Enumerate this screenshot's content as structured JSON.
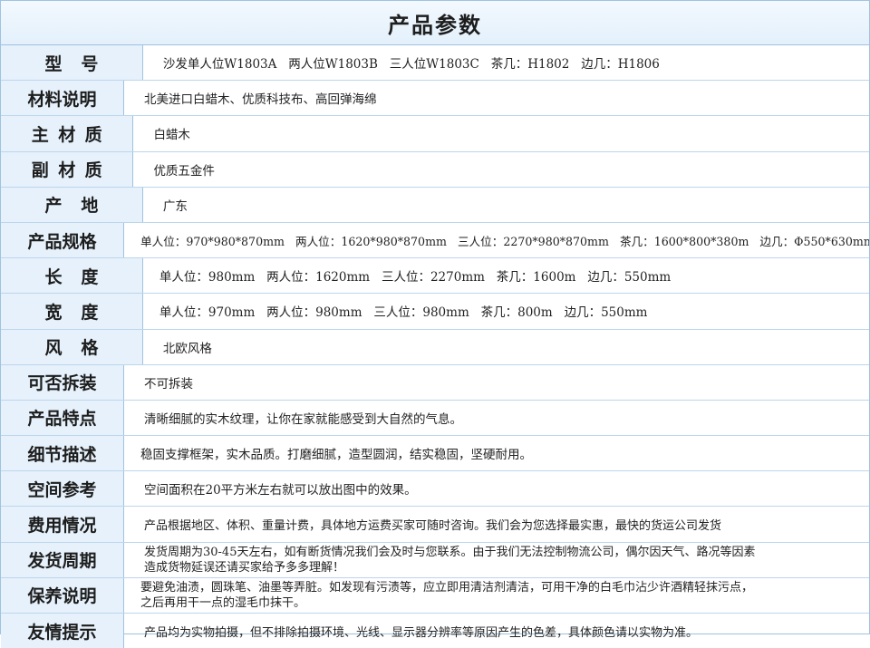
{
  "title": "产品参数",
  "rows": [
    {
      "label": "型号",
      "value": "沙发单人位W1803A   两人位W1803B   三人位W1803C   茶几：H1802   边几：H1806"
    },
    {
      "label": "材料说明",
      "value": "北美进口白蜡木、优质科技布、高回弹海绵"
    },
    {
      "label": "主材质",
      "value": "白蜡木"
    },
    {
      "label": "副材质",
      "value": "优质五金件"
    },
    {
      "label": "产地",
      "value": "广东"
    },
    {
      "label": "产品规格",
      "value": "单人位：970*980*870mm   两人位：1620*980*870mm   三人位：2270*980*870mm   茶几：1600*800*380m   边几：Φ550*630mm"
    },
    {
      "label": "长度",
      "value": "单人位：980mm   两人位：1620mm   三人位：2270mm   茶几：1600m   边几：550mm"
    },
    {
      "label": "宽度",
      "value": "单人位：970mm   两人位：980mm   三人位：980mm   茶几：800m   边几：550mm"
    },
    {
      "label": "风格",
      "value": "北欧风格"
    },
    {
      "label": "可否拆装",
      "value": "不可拆装"
    },
    {
      "label": "产品特点",
      "value": "清晰细腻的实木纹理，让你在家就能感受到大自然的气息。"
    },
    {
      "label": "细节描述",
      "value": "稳固支撑框架，实木品质。打磨细腻，造型圆润，结实稳固，坚硬耐用。"
    },
    {
      "label": "空间参考",
      "value": "空间面积在20平方米左右就可以放出图中的效果。"
    },
    {
      "label": "费用情况",
      "value": "产品根据地区、体积、重量计费，具体地方运费买家可随时咨询。我们会为您选择最实惠，最快的货运公司发货"
    },
    {
      "label": "发货周期",
      "value": "发货周期为30-45天左右，如有断货情况我们会及时与您联系。由于我们无法控制物流公司，偶尔因天气、路况等因素\n造成货物延误还请买家给予多多理解！"
    },
    {
      "label": "保养说明",
      "value": "要避免油渍，圆珠笔、油墨等弄脏。如发现有污渍等，应立即用清洁剂清洁，可用干净的白毛巾沾少许酒精轻抹污点，\n之后再用干一点的湿毛巾抹干。"
    },
    {
      "label": "友情提示",
      "value": "产品均为实物拍摄，但不排除拍摄环境、光线、显示器分辨率等原因产生的色差，具体颜色请以实物为准。"
    }
  ]
}
